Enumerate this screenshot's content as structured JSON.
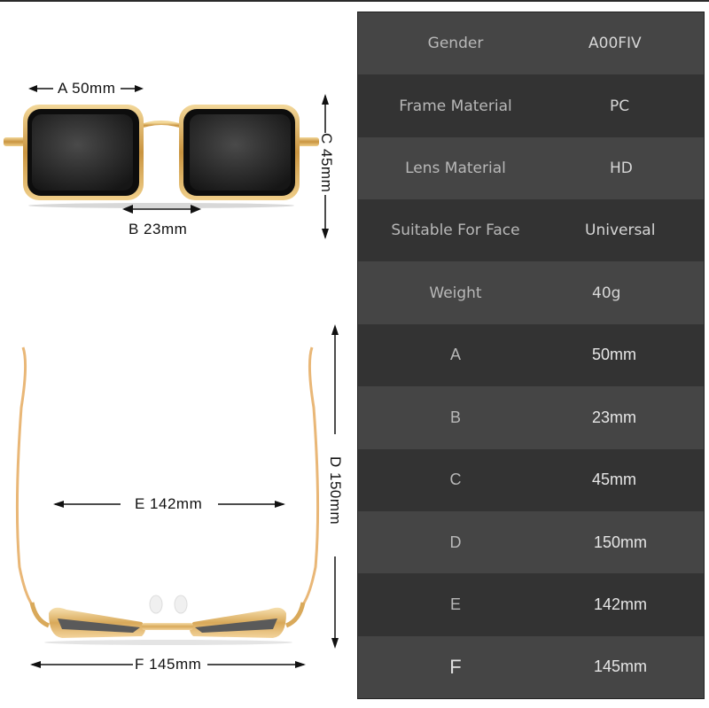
{
  "dimensions": {
    "A": {
      "letter": "A",
      "value": "50mm",
      "label": "A 50mm"
    },
    "B": {
      "letter": "B",
      "value": "23mm",
      "label": "B 23mm"
    },
    "C": {
      "letter": "C",
      "value": "45mm",
      "label": "C 45mm"
    },
    "D": {
      "letter": "D",
      "value": "150mm",
      "label": "D 150mm"
    },
    "E": {
      "letter": "E",
      "value": "142mm",
      "label": "E 142mm"
    },
    "F": {
      "letter": "F",
      "value": "145mm",
      "label": "F 145mm"
    }
  },
  "colors": {
    "frame_gold": "#d9a95a",
    "lens_dark": "#1e1e1e",
    "row_light": "#454545",
    "row_dark": "#333333",
    "key_text": "#b8b8b8",
    "value_text": "#d6d6d6"
  },
  "specs": [
    {
      "key": "Gender",
      "value": "A00FIV"
    },
    {
      "key": "Frame Material",
      "value": "PC"
    },
    {
      "key": "Lens Material",
      "value": "HD"
    },
    {
      "key": "Suitable For Face",
      "value": "Universal"
    },
    {
      "key": "Weight",
      "value": "40g"
    },
    {
      "key": "A",
      "value": "50mm"
    },
    {
      "key": "B",
      "value": "23mm"
    },
    {
      "key": "C",
      "value": "45mm"
    },
    {
      "key": "D",
      "value": "150mm"
    },
    {
      "key": "E",
      "value": "142mm"
    },
    {
      "key": "F",
      "value": "145mm"
    }
  ]
}
